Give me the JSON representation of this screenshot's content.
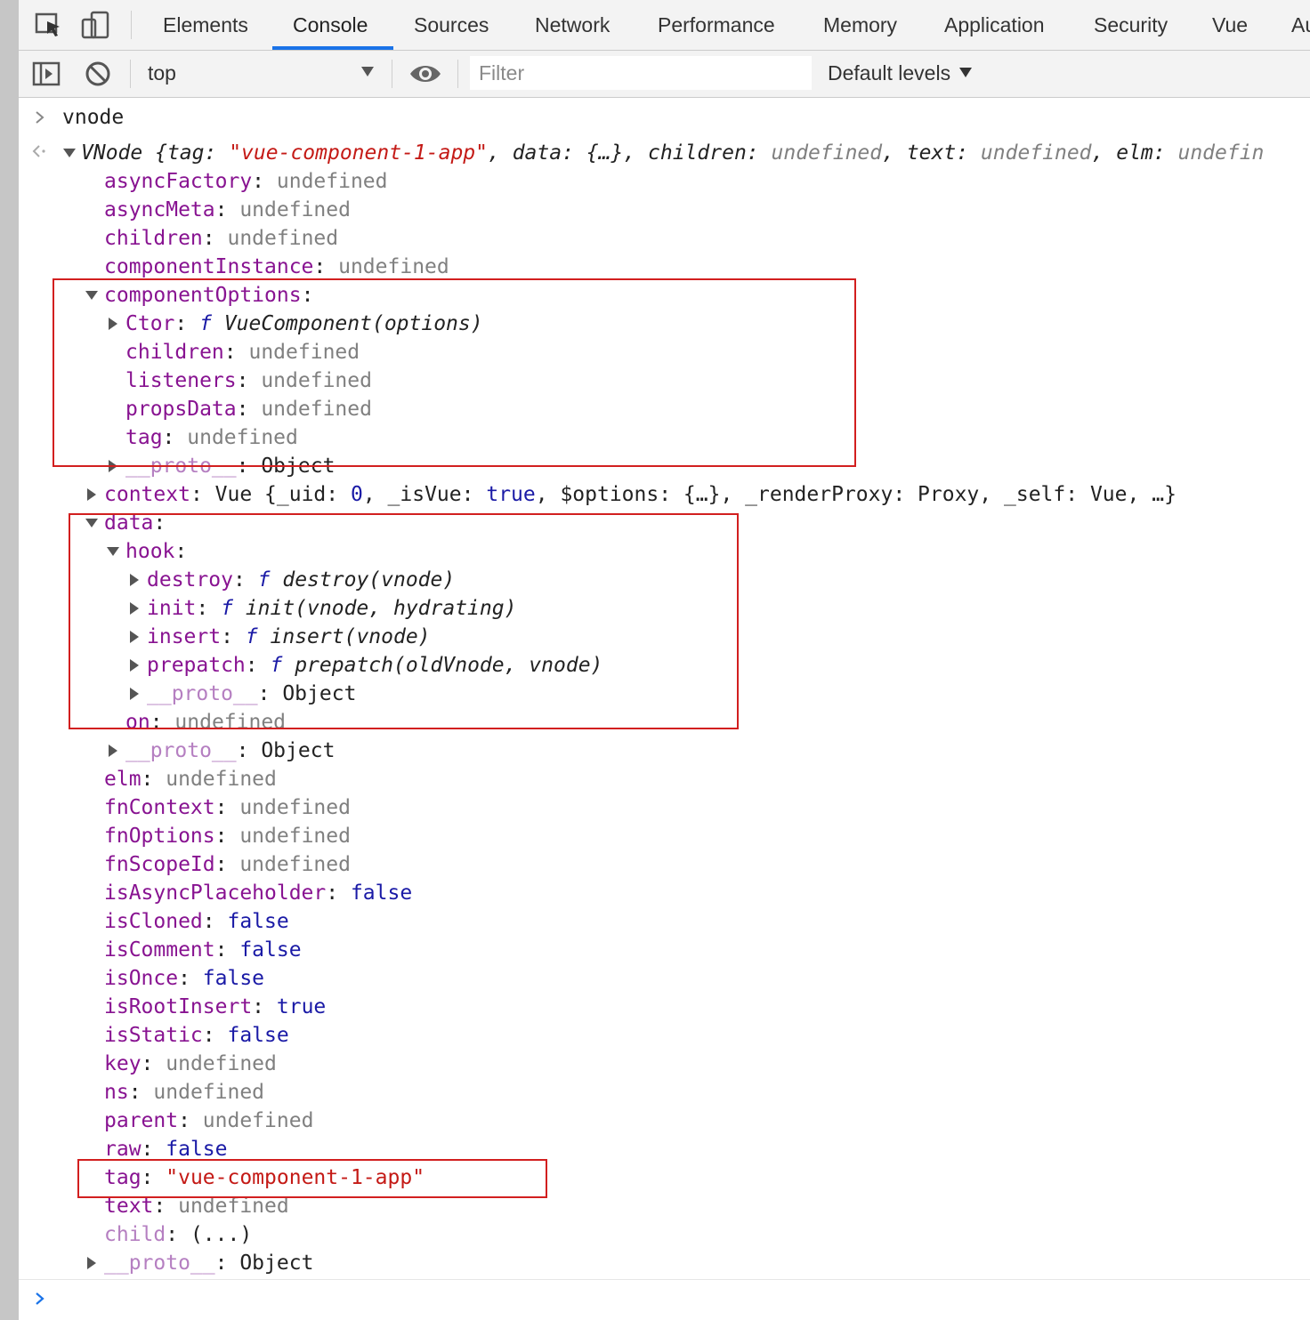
{
  "tabs": [
    {
      "label": "Elements",
      "active": false
    },
    {
      "label": "Console",
      "active": true
    },
    {
      "label": "Sources",
      "active": false
    },
    {
      "label": "Network",
      "active": false
    },
    {
      "label": "Performance",
      "active": false
    },
    {
      "label": "Memory",
      "active": false
    },
    {
      "label": "Application",
      "active": false
    },
    {
      "label": "Security",
      "active": false
    },
    {
      "label": "Vue",
      "active": false
    },
    {
      "label": "Au",
      "active": false
    }
  ],
  "toolbar": {
    "context": "top",
    "filter_placeholder": "Filter",
    "levels": "Default levels"
  },
  "console": {
    "input_command": "vnode",
    "result_head": {
      "type": "VNode",
      "tag_key": "tag",
      "tag_val": "\"vue-component-1-app\"",
      "rest1": ", data: {…}, children: ",
      "undef": "undefined",
      "rest2": ", text: ",
      "rest3": ", elm: ",
      "tail": "undefin"
    },
    "properties": {
      "asyncFactory": "undefined",
      "asyncMeta": "undefined",
      "children": "undefined",
      "componentInstance": "undefined",
      "componentOptions": {
        "Ctor": "VueComponent(options)",
        "children": "undefined",
        "listeners": "undefined",
        "propsData": "undefined",
        "tag": "undefined",
        "proto": "Object"
      },
      "context_summary": {
        "type": "Vue",
        "uid_key": "_uid",
        "uid": "0",
        "isVue_key": "_isVue",
        "isVue": "true",
        "options_key": "$options",
        "options": "{…}",
        "renderProxy_key": "_renderProxy",
        "renderProxy": "Proxy",
        "self_key": "_self",
        "self": "Vue",
        "more": "…"
      },
      "data": {
        "hook": {
          "destroy": "destroy(vnode)",
          "init": "init(vnode, hydrating)",
          "insert": "insert(vnode)",
          "prepatch": "prepatch(oldVnode, vnode)",
          "proto": "Object"
        },
        "on": "undefined",
        "proto": "Object"
      },
      "elm": "undefined",
      "fnContext": "undefined",
      "fnOptions": "undefined",
      "fnScopeId": "undefined",
      "isAsyncPlaceholder": "false",
      "isCloned": "false",
      "isComment": "false",
      "isOnce": "false",
      "isRootInsert": "true",
      "isStatic": "false",
      "key": "undefined",
      "ns": "undefined",
      "parent": "undefined",
      "raw": "false",
      "tag": "\"vue-component-1-app\"",
      "text": "undefined",
      "child": "(...)",
      "proto": "Object"
    },
    "labels": {
      "proto_key": "__proto__",
      "fn_glyph": "f"
    }
  },
  "colors": {
    "accent": "#1a73e8",
    "highlight_box": "#d21f1f",
    "key": "#881391",
    "string": "#c41a16",
    "keyword": "#1a1aa6",
    "undefined": "#808080"
  },
  "icons": [
    "inspect-element-icon",
    "device-toggle-icon",
    "sidebar-toggle-icon",
    "clear-console-icon",
    "eye-icon",
    "prompt-chevron-icon",
    "result-arrow-icon"
  ]
}
